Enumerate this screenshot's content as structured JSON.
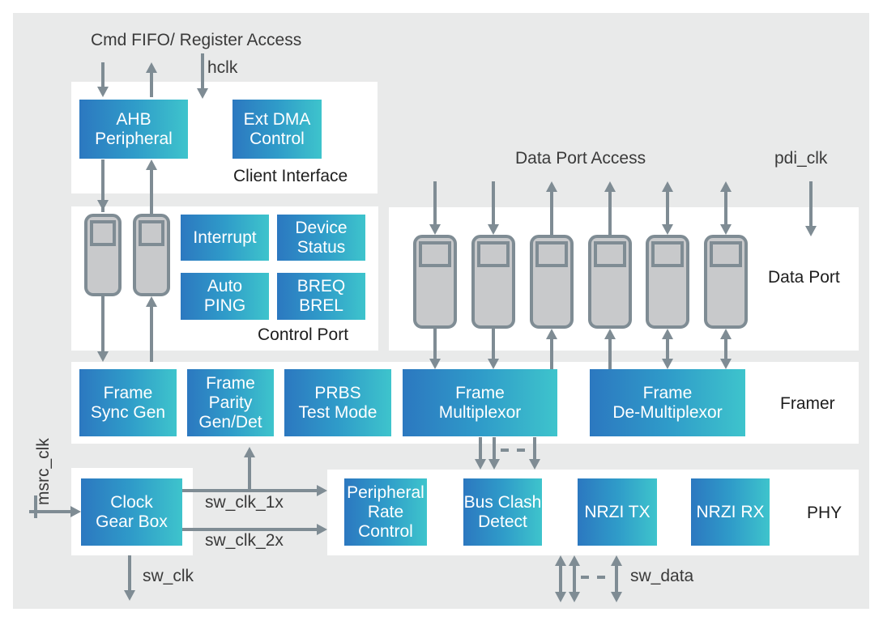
{
  "diagram": {
    "colors": {
      "block_gradient_start": "#2c78c0",
      "block_gradient_end": "#3ec4cc",
      "arrow": "#7f8c94",
      "fifo_fill": "#c8c9cb",
      "fifo_stroke": "#7f8c94",
      "background": "#e9eaea",
      "panel": "#ffffff"
    },
    "external_signals": {
      "cmd_fifo": "Cmd FIFO/ Register Access",
      "hclk": "hclk",
      "data_port_access": "Data Port Access",
      "pdi_clk": "pdi_clk",
      "msrc_clk": "msrc_clk",
      "sw_clk": "sw_clk",
      "sw_clk_1x": "sw_clk_1x",
      "sw_clk_2x": "sw_clk_2x",
      "sw_data": "sw_data"
    },
    "sections": {
      "client_interface": {
        "label": "Client Interface",
        "blocks": [
          "AHB\nPeripheral",
          "Ext DMA\nControl"
        ]
      },
      "control_port": {
        "label": "Control Port",
        "fifo_count": 2,
        "blocks": [
          "Interrupt",
          "Device\nStatus",
          "Auto\nPING",
          "BREQ\nBREL"
        ]
      },
      "data_port": {
        "label": "Data Port",
        "fifo_count": 6,
        "fifo_directions": [
          "in",
          "in",
          "out",
          "out",
          "bidirectional",
          "bidirectional"
        ]
      },
      "framer": {
        "label": "Framer",
        "blocks": [
          "Frame\nSync Gen",
          "Frame\nParity\nGen/Det",
          "PRBS\nTest Mode",
          "Frame\nMultiplexor",
          "Frame\nDe-Multiplexor"
        ]
      },
      "clock": {
        "blocks": [
          "Clock\nGear Box"
        ]
      },
      "phy": {
        "label": "PHY",
        "blocks": [
          "Peripheral\nRate\nControl",
          "Bus Clash\nDetect",
          "NRZI TX",
          "NRZI RX"
        ]
      }
    }
  }
}
